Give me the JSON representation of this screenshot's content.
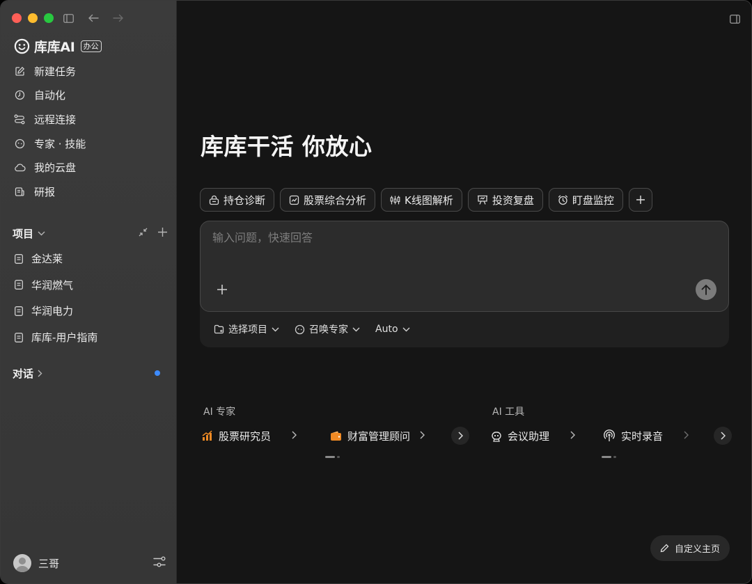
{
  "sidebar": {
    "logo_text": "库库AI",
    "logo_badge": "办公",
    "nav": [
      {
        "label": "新建任务",
        "icon": "edit-icon"
      },
      {
        "label": "自动化",
        "icon": "clock-icon"
      },
      {
        "label": "远程连接",
        "icon": "route-icon"
      },
      {
        "label": "专家 · 技能",
        "icon": "face-icon"
      },
      {
        "label": "我的云盘",
        "icon": "cloud-icon"
      },
      {
        "label": "研报",
        "icon": "report-icon"
      }
    ],
    "projects_header": "项目",
    "projects": [
      "金达莱",
      "华润燃气",
      "华润电力",
      "库库-用户指南"
    ],
    "chats_header": "对话",
    "user_name": "三哥"
  },
  "main": {
    "hero": "库库干活 你放心",
    "chips": [
      {
        "label": "持仓诊断",
        "icon": "lock-box-icon"
      },
      {
        "label": "股票综合分析",
        "icon": "chart-box-icon"
      },
      {
        "label": "K线图解析",
        "icon": "candlestick-icon"
      },
      {
        "label": "投资复盘",
        "icon": "presentation-icon"
      },
      {
        "label": "盯盘监控",
        "icon": "alarm-icon"
      }
    ],
    "compose_placeholder": "输入问题，快速回答",
    "options": {
      "project": "选择项目",
      "expert": "召唤专家",
      "model": "Auto"
    },
    "ai_experts_title": "AI 专家",
    "ai_experts": [
      {
        "label": "股票研究员",
        "icon": "bar-chart-icon",
        "color": "#f08a24"
      },
      {
        "label": "财富管理顾问",
        "icon": "wallet-icon",
        "color": "#f08a24"
      }
    ],
    "ai_tools_title": "AI 工具",
    "ai_tools": [
      {
        "label": "会议助理",
        "icon": "robot-icon"
      },
      {
        "label": "实时录音",
        "icon": "broadcast-icon"
      }
    ],
    "customize_label": "自定义主页"
  },
  "colors": {
    "sidebar_bg": "#393939",
    "main_bg": "#151515",
    "accent_orange": "#f08a24",
    "unread_dot": "#3d8bfd"
  }
}
